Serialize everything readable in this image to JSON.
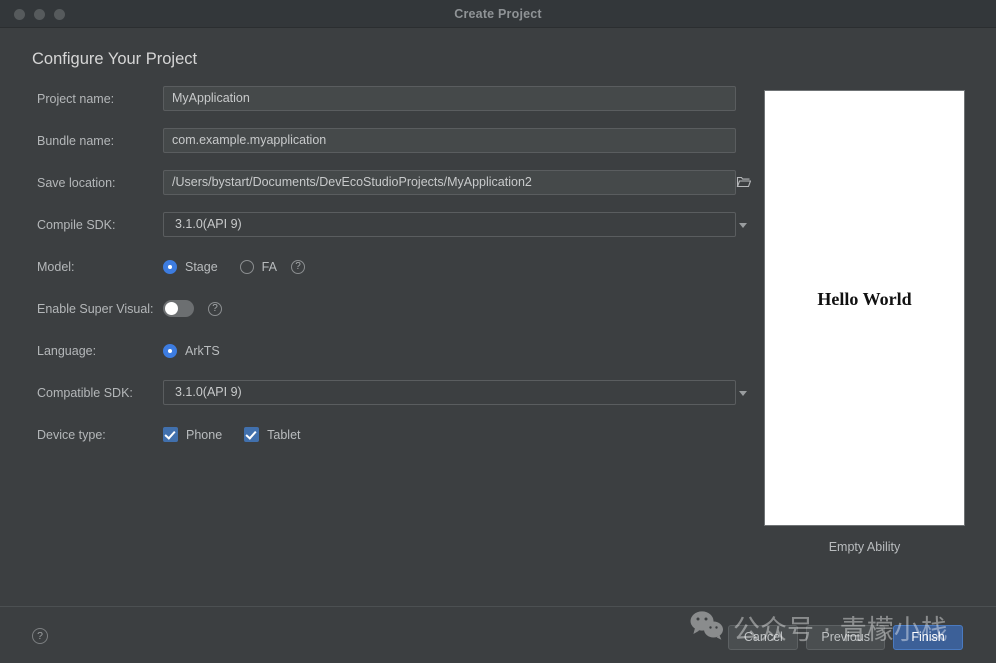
{
  "window": {
    "title": "Create Project",
    "traffic_lights": [
      "close-button",
      "minimize-button",
      "maximize-button"
    ]
  },
  "page": {
    "heading": "Configure Your Project"
  },
  "form": {
    "project_name": {
      "label": "Project name:",
      "value": "MyApplication"
    },
    "bundle_name": {
      "label": "Bundle name:",
      "value": "com.example.myapplication"
    },
    "save_location": {
      "label": "Save location:",
      "value": "/Users/bystart/Documents/DevEcoStudioProjects/MyApplication2",
      "browse_icon": "folder-icon"
    },
    "compile_sdk": {
      "label": "Compile SDK:",
      "value": "3.1.0(API 9)",
      "options": [
        "3.1.0(API 9)"
      ]
    },
    "model": {
      "label": "Model:",
      "options": [
        "Stage",
        "FA"
      ],
      "selected": "Stage",
      "help_icon": "help-icon"
    },
    "super_visual": {
      "label": "Enable Super Visual:",
      "enabled": false,
      "help_icon": "help-icon"
    },
    "language": {
      "label": "Language:",
      "options": [
        "ArkTS"
      ],
      "selected": "ArkTS"
    },
    "compatible_sdk": {
      "label": "Compatible SDK:",
      "value": "3.1.0(API 9)",
      "options": [
        "3.1.0(API 9)"
      ]
    },
    "device_type": {
      "label": "Device type:",
      "options": [
        {
          "label": "Phone",
          "checked": true
        },
        {
          "label": "Tablet",
          "checked": true
        }
      ]
    }
  },
  "preview": {
    "screen_text": "Hello World",
    "caption": "Empty Ability"
  },
  "footer": {
    "help_icon": "?",
    "cancel_label": "Cancel",
    "previous_label": "Previous",
    "finish_label": "Finish"
  },
  "watermark": {
    "text": "公众号 · 青檬小栈",
    "logo": "wechat-icon"
  },
  "colors": {
    "window_background": "#3c3f41",
    "titlebar": "#33373a",
    "input_fill": "#45494a",
    "accent_blue": "#3d7ce0",
    "primary_button": "#3c6098",
    "checkbox_blue": "#4170ad"
  }
}
